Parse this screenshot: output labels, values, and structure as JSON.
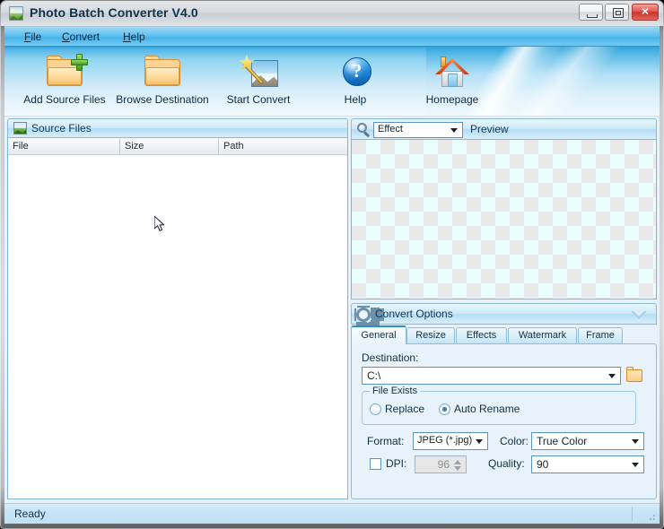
{
  "window": {
    "title": "Photo Batch Converter V4.0",
    "app_icon": "photo-icon",
    "minimize_label": "Minimize",
    "maximize_label": "Maximize",
    "close_label": "✕"
  },
  "menubar": {
    "items": [
      {
        "label": "File",
        "accel": "F"
      },
      {
        "label": "Convert",
        "accel": "C"
      },
      {
        "label": "Help",
        "accel": "H"
      }
    ]
  },
  "toolbar": {
    "buttons": [
      {
        "label": "Add Source Files",
        "icon": "folder-add-icon"
      },
      {
        "label": "Browse Destination",
        "icon": "folder-icon"
      },
      {
        "label": "Start Convert",
        "icon": "magic-wand-image-icon"
      },
      {
        "label": "Help",
        "icon": "question-mark-icon"
      },
      {
        "label": "Homepage",
        "icon": "home-icon"
      }
    ]
  },
  "source_panel": {
    "title": "Source Files",
    "icon": "image-icon",
    "columns": [
      "File",
      "Size",
      "Path"
    ],
    "rows": []
  },
  "preview_panel": {
    "icon": "magnifier-icon",
    "effect_combo": {
      "value": "Effect",
      "options": [
        "Effect"
      ]
    },
    "preview_label": "Preview"
  },
  "convert_options": {
    "title": "Convert Options",
    "icon": "gear-icon",
    "collapse_icon": "chevron-down-icon",
    "tabs": [
      {
        "label": "General",
        "active": true
      },
      {
        "label": "Resize",
        "active": false
      },
      {
        "label": "Effects",
        "active": false
      },
      {
        "label": "Watermark",
        "active": false
      },
      {
        "label": "Frame",
        "active": false
      }
    ],
    "general": {
      "destination_label": "Destination:",
      "destination_value": "C:\\",
      "browse_icon": "folder-open-icon",
      "file_exists": {
        "legend": "File Exists",
        "replace_label": "Replace",
        "replace_checked": false,
        "auto_rename_label": "Auto Rename",
        "auto_rename_checked": true
      },
      "format_label": "Format:",
      "format_value": "JPEG (*.jpg)",
      "color_label": "Color:",
      "color_value": "True Color",
      "dpi_label": "DPI:",
      "dpi_checked": false,
      "dpi_value": "96",
      "quality_label": "Quality:",
      "quality_value": "90"
    }
  },
  "statusbar": {
    "text": "Ready",
    "grip": "resize-grip"
  },
  "colors": {
    "accent_blue": "#2a8fd0",
    "titlebar": "#d6dadf",
    "menubar_blue": "#46b3ea",
    "client_bg": "#e7f2fa",
    "close_red": "#c93428"
  }
}
